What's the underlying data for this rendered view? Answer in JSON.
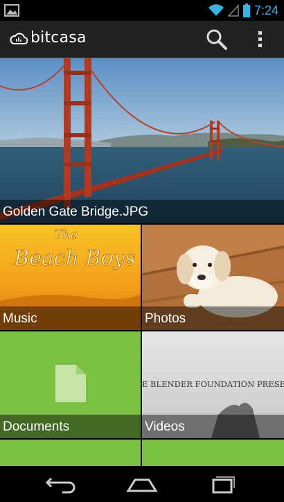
{
  "status_bar": {
    "time": "7:24",
    "icons": [
      "image-notification-icon",
      "wifi-icon",
      "signal-icon",
      "battery-icon"
    ]
  },
  "action_bar": {
    "brand": "bitcasa",
    "actions": [
      "search-icon",
      "overflow-menu-icon"
    ]
  },
  "tiles": {
    "hero": {
      "label": "Golden Gate Bridge.JPG"
    },
    "music": {
      "label": "Music",
      "artwork_text_line1": "The",
      "artwork_text_line2": "Beach Boys"
    },
    "photos": {
      "label": "Photos"
    },
    "documents": {
      "label": "Documents",
      "icon": "document-icon"
    },
    "videos": {
      "label": "Videos",
      "artwork_text": "E BLENDER FOUNDATION PRESEN"
    }
  },
  "nav_bar": {
    "buttons": [
      "back-icon",
      "home-icon",
      "recent-apps-icon"
    ]
  },
  "colors": {
    "accent_blue": "#33b5e5",
    "tile_green": "#7ac142",
    "actionbar": "#222222"
  }
}
